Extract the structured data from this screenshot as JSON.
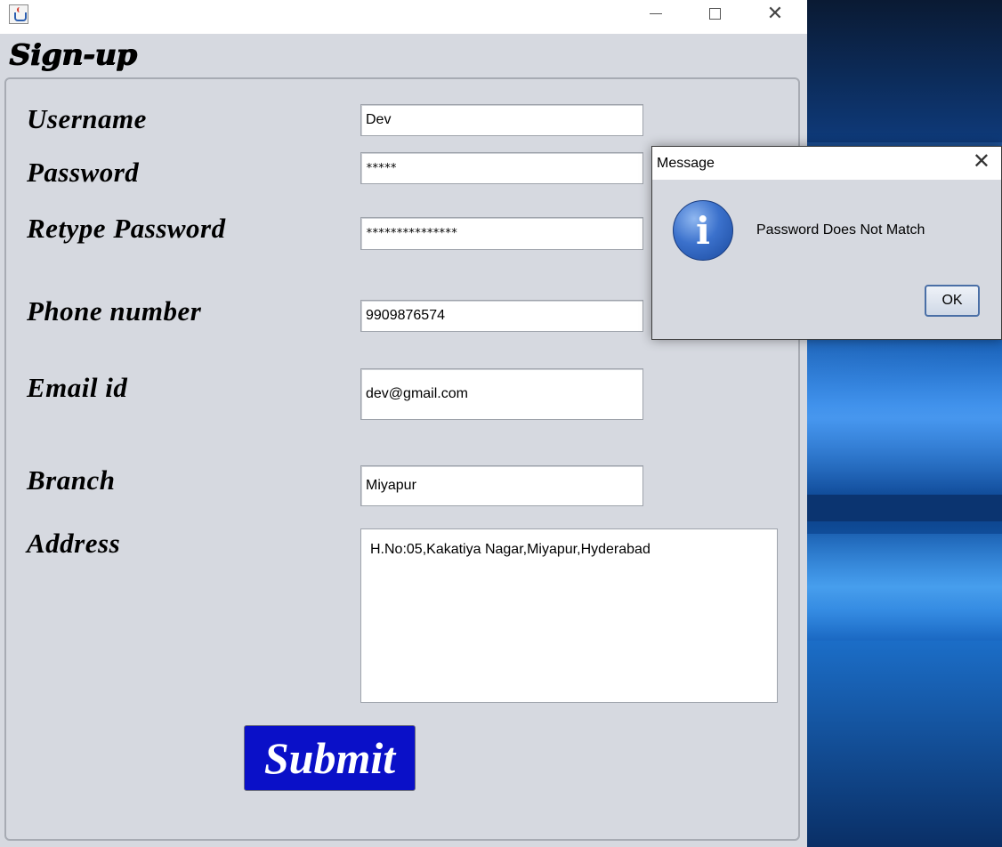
{
  "desktop": {},
  "window": {
    "controls": {
      "minimize": "—",
      "maximize": "☐",
      "close": "✕"
    }
  },
  "form": {
    "title": "Sign-up",
    "fields": {
      "username": {
        "label": "Username",
        "value": "Dev"
      },
      "password": {
        "label": "Password",
        "value": "*****"
      },
      "retype_password": {
        "label": "Retype Password",
        "value": "***************"
      },
      "phone": {
        "label": "Phone number",
        "value": "9909876574"
      },
      "email": {
        "label": "Email id",
        "value": "dev@gmail.com"
      },
      "branch": {
        "label": "Branch",
        "value": "Miyapur"
      },
      "address": {
        "label": "Address",
        "value": "H.No:05,Kakatiya Nagar,Miyapur,Hyderabad"
      }
    },
    "submit_label": "Submit"
  },
  "dialog": {
    "title": "Message",
    "close": "✕",
    "icon": "info-icon",
    "icon_glyph": "i",
    "message": "Password Does Not Match",
    "ok_label": "OK"
  },
  "colors": {
    "submit_bg": "#0a10c8",
    "window_bg": "#d6d9e0"
  }
}
